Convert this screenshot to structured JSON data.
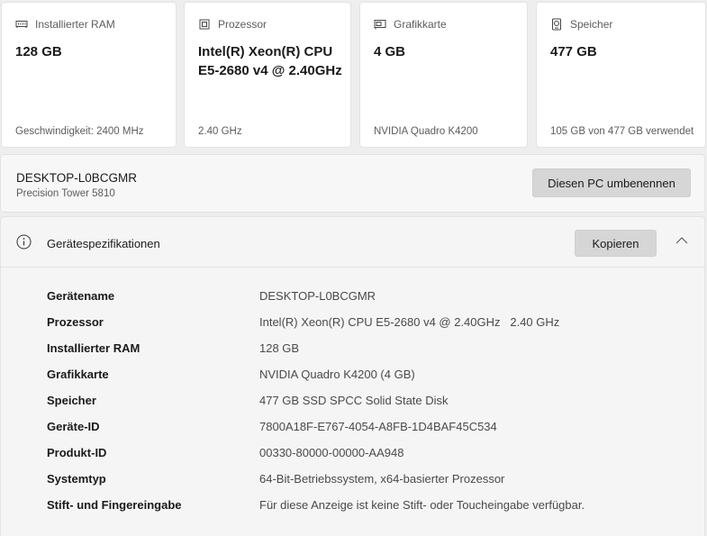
{
  "cards": [
    {
      "label": "Installierter RAM",
      "icon": "ram-icon",
      "value": "128 GB",
      "footer": "Geschwindigkeit: 2400 MHz"
    },
    {
      "label": "Prozessor",
      "icon": "processor-icon",
      "value": "Intel(R) Xeon(R) CPU E5-2680 v4 @ 2.40GHz",
      "footer": "2.40 GHz"
    },
    {
      "label": "Grafikkarte",
      "icon": "graphics-card-icon",
      "value": "4 GB",
      "footer": "NVIDIA Quadro K4200"
    },
    {
      "label": "Speicher",
      "icon": "storage-icon",
      "value": "477 GB",
      "footer": "105 GB von 477 GB verwendet"
    }
  ],
  "pc": {
    "name": "DESKTOP-L0BCGMR",
    "model": "Precision Tower 5810",
    "rename_label": "Diesen PC umbenennen"
  },
  "specs": {
    "title": "Gerätespezifikationen",
    "copy_label": "Kopieren",
    "rows": [
      {
        "key": "Gerätename",
        "value": "DESKTOP-L0BCGMR"
      },
      {
        "key": "Prozessor",
        "value": "Intel(R) Xeon(R) CPU E5-2680 v4 @ 2.40GHz   2.40 GHz"
      },
      {
        "key": "Installierter RAM",
        "value": "128 GB"
      },
      {
        "key": "Grafikkarte",
        "value": "NVIDIA Quadro K4200 (4 GB)"
      },
      {
        "key": "Speicher",
        "value": "477 GB SSD SPCC Solid State Disk"
      },
      {
        "key": "Geräte-ID",
        "value": "7800A18F-E767-4054-A8FB-1D4BAF45C534"
      },
      {
        "key": "Produkt-ID",
        "value": "00330-80000-00000-AA948"
      },
      {
        "key": "Systemtyp",
        "value": "64-Bit-Betriebssystem, x64-basierter Prozessor"
      },
      {
        "key": "Stift- und Fingereingabe",
        "value": "Für diese Anzeige ist keine Stift- oder Toucheingabe verfügbar."
      }
    ]
  }
}
